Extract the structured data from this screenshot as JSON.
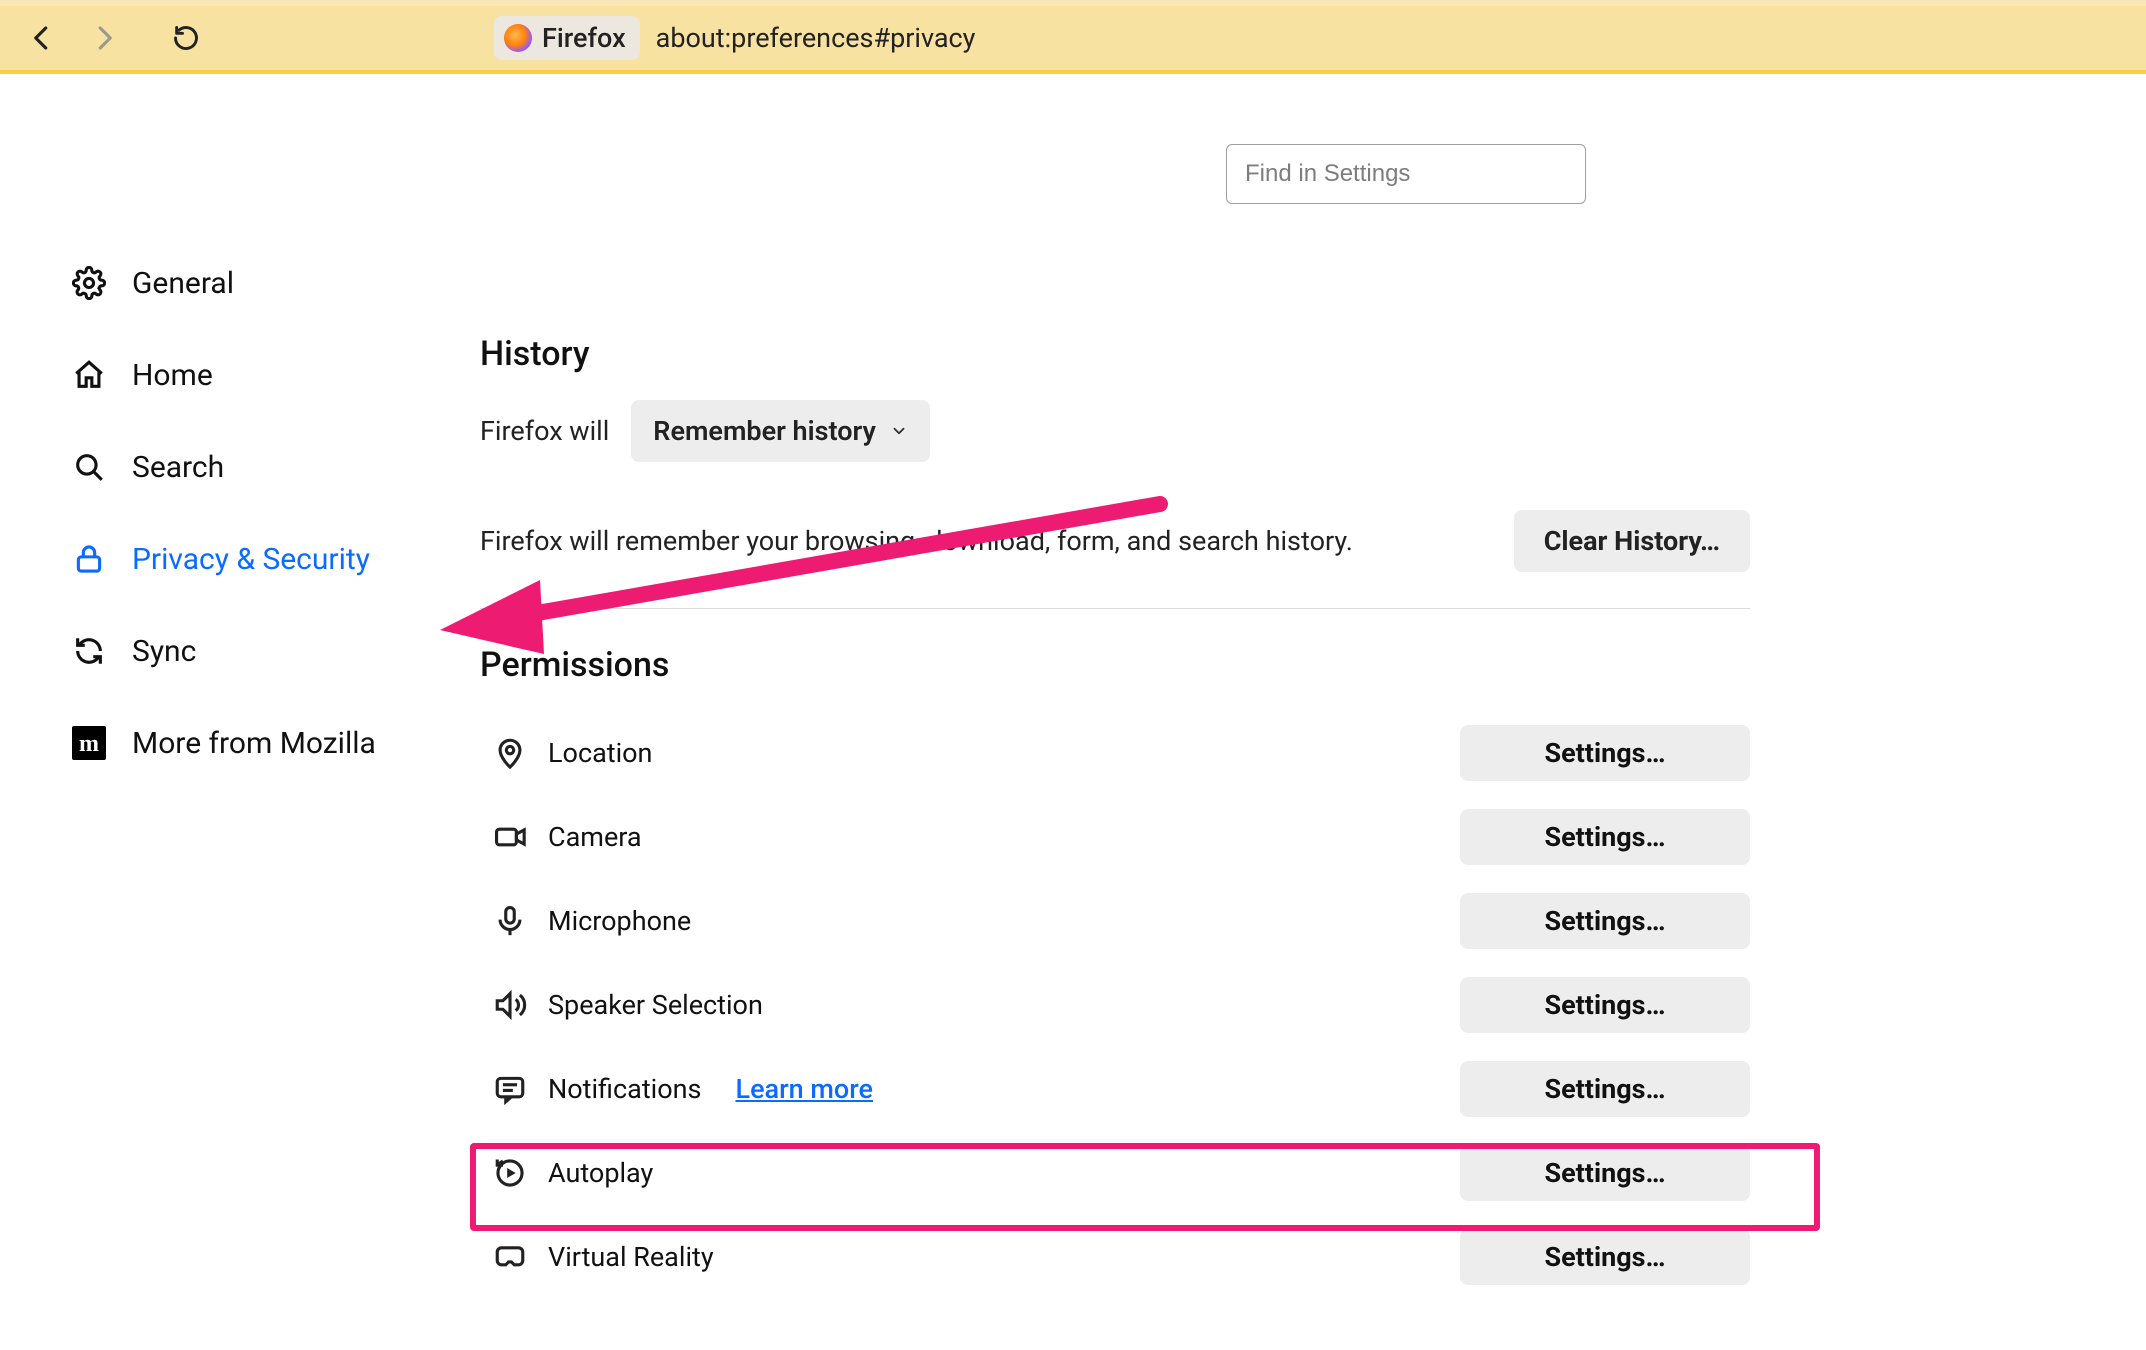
{
  "toolbar": {
    "app_name": "Firefox",
    "url": "about:preferences#privacy"
  },
  "search": {
    "placeholder": "Find in Settings"
  },
  "sidebar": {
    "items": [
      {
        "label": "General"
      },
      {
        "label": "Home"
      },
      {
        "label": "Search"
      },
      {
        "label": "Privacy & Security"
      },
      {
        "label": "Sync"
      },
      {
        "label": "More from Mozilla"
      }
    ]
  },
  "history": {
    "heading": "History",
    "prefix_label": "Firefox will",
    "mode_selected": "Remember history",
    "description": "Firefox will remember your browsing, download, form, and search history.",
    "clear_button": "Clear History…"
  },
  "permissions": {
    "heading": "Permissions",
    "learn_more": "Learn more",
    "settings_button": "Settings…",
    "items": [
      {
        "label": "Location"
      },
      {
        "label": "Camera"
      },
      {
        "label": "Microphone"
      },
      {
        "label": "Speaker Selection"
      },
      {
        "label": "Notifications",
        "has_learn_more": true
      },
      {
        "label": "Autoplay"
      },
      {
        "label": "Virtual Reality"
      }
    ]
  },
  "colors": {
    "accent": "#0a6bff",
    "annotation": "#ed1b71"
  }
}
